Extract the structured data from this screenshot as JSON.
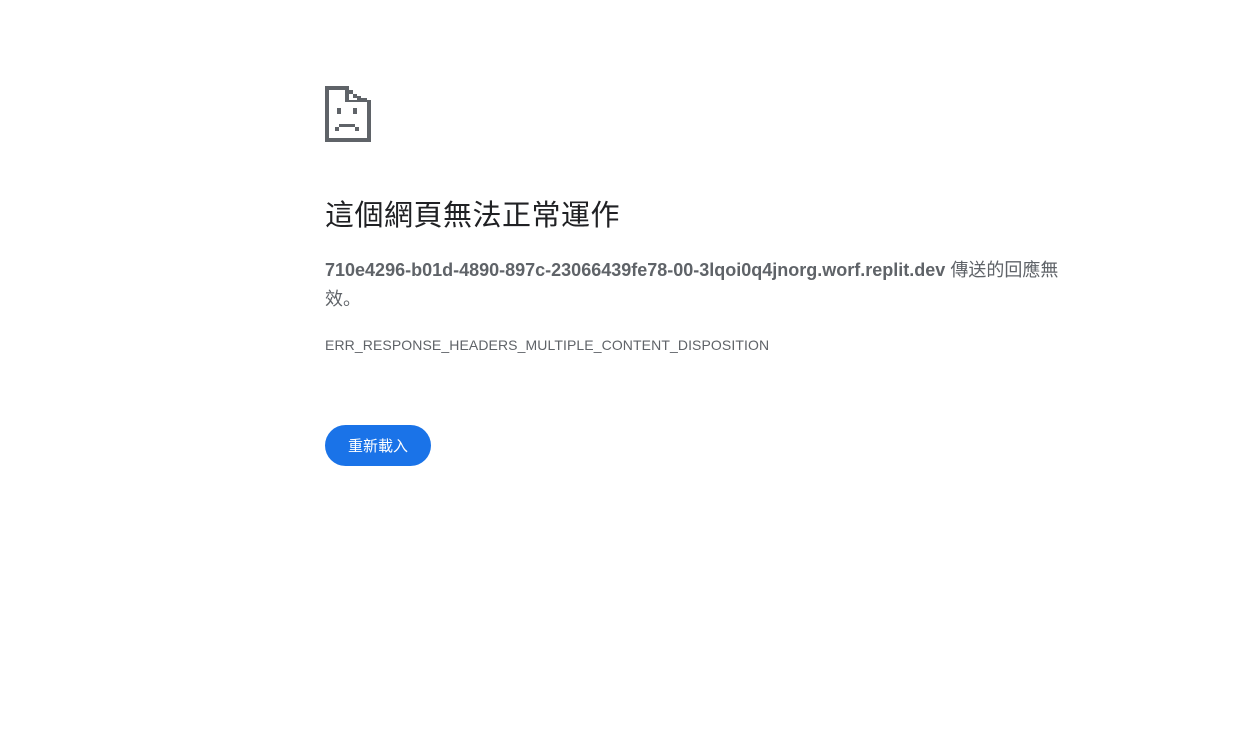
{
  "error_page": {
    "icon": "sad-page-icon",
    "heading": "這個網頁無法正常運作",
    "host": "710e4296-b01d-4890-897c-23066439fe78-00-3lqoi0q4jnorg.worf.replit.dev",
    "message_suffix": " 傳送的回應無效。",
    "error_code": "ERR_RESPONSE_HEADERS_MULTIPLE_CONTENT_DISPOSITION",
    "reload_label": "重新載入"
  },
  "colors": {
    "accent": "#1a73e8",
    "text_primary": "#202124",
    "text_secondary": "#5f6368"
  }
}
